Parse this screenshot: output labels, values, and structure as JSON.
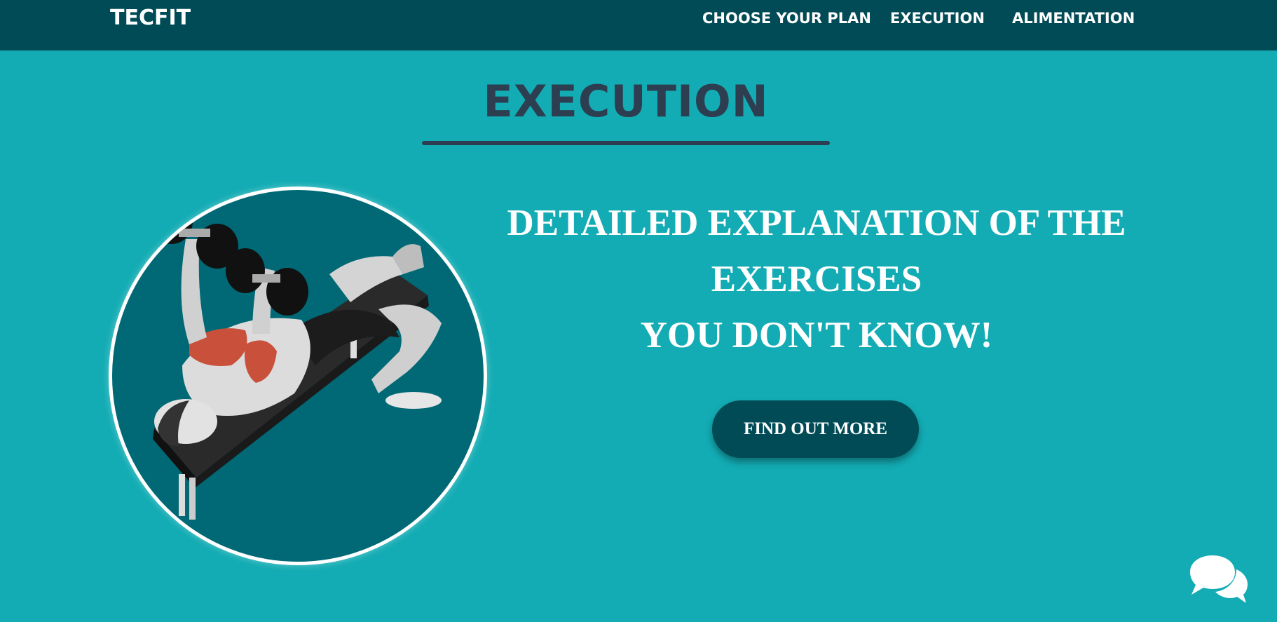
{
  "nav": {
    "brand": "TECFIT",
    "links": [
      {
        "label": "CHOOSE YOUR PLAN"
      },
      {
        "label": "EXECUTION"
      },
      {
        "label": "ALIMENTATION"
      }
    ]
  },
  "section": {
    "title": "EXECUTION"
  },
  "hero": {
    "headline_line1": "DETAILED EXPLANATION OF THE",
    "headline_line2": "EXERCISES",
    "headline_line3": "YOU DON'T KNOW!",
    "cta_label": "FIND OUT MORE",
    "image_icon": "bench-press-illustration-icon"
  },
  "chat": {
    "icon": "chat-bubbles-icon"
  },
  "colors": {
    "page_background": "#13acb4",
    "navbar_background": "#004b56",
    "title_color": "#2c3e50",
    "circle_background": "#006975",
    "button_background": "#004b56",
    "text_light": "#ffffff"
  }
}
